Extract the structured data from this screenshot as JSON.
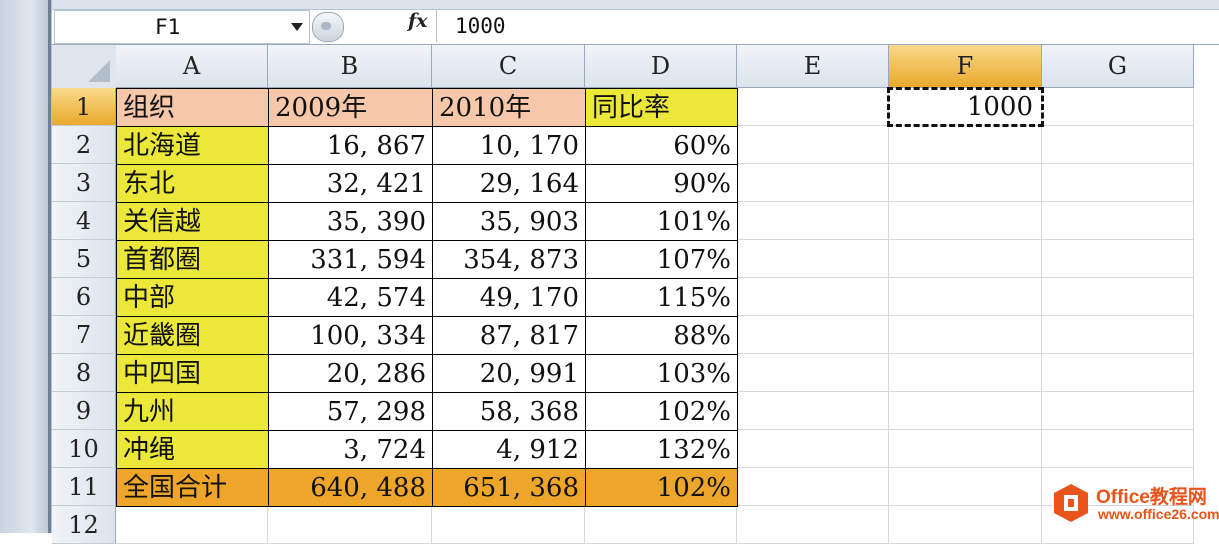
{
  "name_box": "F1",
  "formula_icon": "fx-icon",
  "formula_value": "1000",
  "columns": [
    "A",
    "B",
    "C",
    "D",
    "E",
    "F",
    "G"
  ],
  "active_column": "F",
  "rows": [
    "1",
    "2",
    "3",
    "4",
    "5",
    "6",
    "7",
    "8",
    "9",
    "10",
    "11",
    "12"
  ],
  "active_row": "1",
  "table": {
    "header": [
      "组织",
      "2009年",
      "2010年",
      "同比率"
    ],
    "body": [
      [
        "北海道",
        "16, 867",
        "10, 170",
        "60%"
      ],
      [
        "东北",
        "32, 421",
        "29, 164",
        "90%"
      ],
      [
        "关信越",
        "35, 390",
        "35, 903",
        "101%"
      ],
      [
        "首都圈",
        "331, 594",
        "354, 873",
        "107%"
      ],
      [
        "中部",
        "42, 574",
        "49, 170",
        "115%"
      ],
      [
        "近畿圈",
        "100, 334",
        "87, 817",
        "88%"
      ],
      [
        "中四国",
        "20, 286",
        "20, 991",
        "103%"
      ],
      [
        "九州",
        "57, 298",
        "58, 368",
        "102%"
      ],
      [
        "冲绳",
        "3, 724",
        "4, 912",
        "132%"
      ]
    ],
    "total": [
      "全国合计",
      "640, 488",
      "651, 368",
      "102%"
    ]
  },
  "f1_value": "1000",
  "colors": {
    "header_fill": "#f6c7a9",
    "org_fill": "#ece83a",
    "total_fill": "#eda62a",
    "active_header": "#eab14a",
    "watermark": "#e8541a"
  },
  "watermark": {
    "title": "Office教程网",
    "url": "www.office26.com"
  }
}
